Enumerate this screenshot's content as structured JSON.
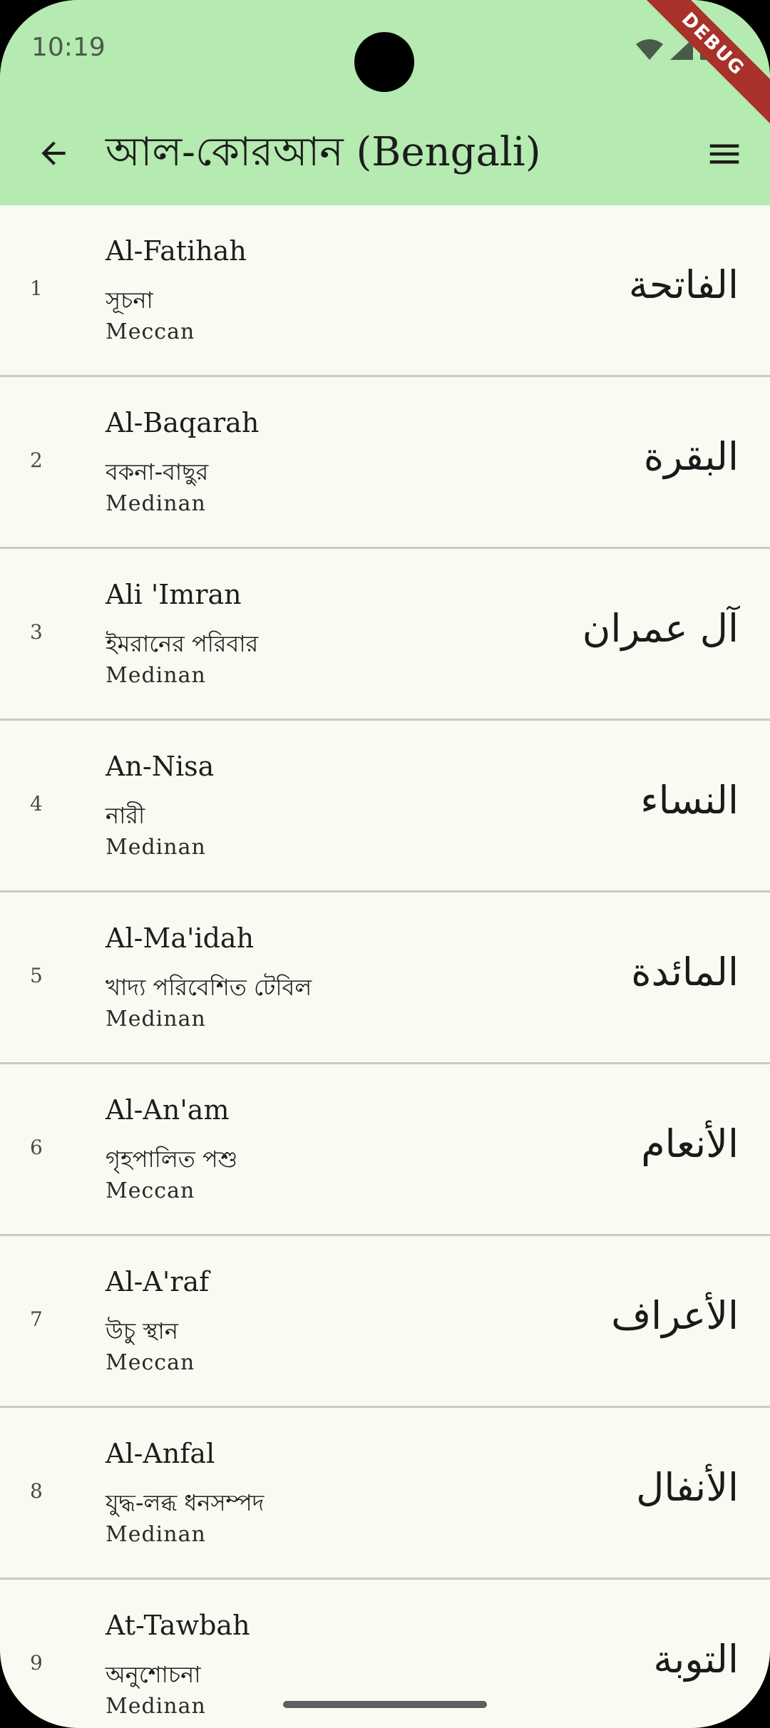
{
  "status": {
    "time": "10:19",
    "debug_label": "DEBUG"
  },
  "appbar": {
    "title": "আল-কোরআন (Bengali)",
    "back_icon": "arrow-left-icon",
    "menu_icon": "hamburger-menu-icon"
  },
  "colors": {
    "appbar_bg": "#b5eab0",
    "list_bg": "#f8fbf1",
    "divider": "#c9cbc5",
    "debug_ribbon": "#a8312a"
  },
  "surahs": [
    {
      "number": "1",
      "name_en": "Al-Fatihah",
      "name_bn": "সূচনা",
      "origin": "Meccan",
      "name_ar": "الفاتحة"
    },
    {
      "number": "2",
      "name_en": "Al-Baqarah",
      "name_bn": "বকনা-বাছুর",
      "origin": "Medinan",
      "name_ar": "البقرة"
    },
    {
      "number": "3",
      "name_en": "Ali 'Imran",
      "name_bn": "ইমরানের পরিবার",
      "origin": "Medinan",
      "name_ar": "آل عمران"
    },
    {
      "number": "4",
      "name_en": "An-Nisa",
      "name_bn": "নারী",
      "origin": "Medinan",
      "name_ar": "النساء"
    },
    {
      "number": "5",
      "name_en": "Al-Ma'idah",
      "name_bn": "খাদ্য পরিবেশিত টেবিল",
      "origin": "Medinan",
      "name_ar": "المائدة"
    },
    {
      "number": "6",
      "name_en": "Al-An'am",
      "name_bn": "গৃহপালিত পশু",
      "origin": "Meccan",
      "name_ar": "الأنعام"
    },
    {
      "number": "7",
      "name_en": "Al-A'raf",
      "name_bn": "উচু স্থান",
      "origin": "Meccan",
      "name_ar": "الأعراف"
    },
    {
      "number": "8",
      "name_en": "Al-Anfal",
      "name_bn": "যুদ্ধ-লব্ধ ধনসম্পদ",
      "origin": "Medinan",
      "name_ar": "الأنفال"
    },
    {
      "number": "9",
      "name_en": "At-Tawbah",
      "name_bn": "অনুশোচনা",
      "origin": "Medinan",
      "name_ar": "التوبة"
    }
  ]
}
